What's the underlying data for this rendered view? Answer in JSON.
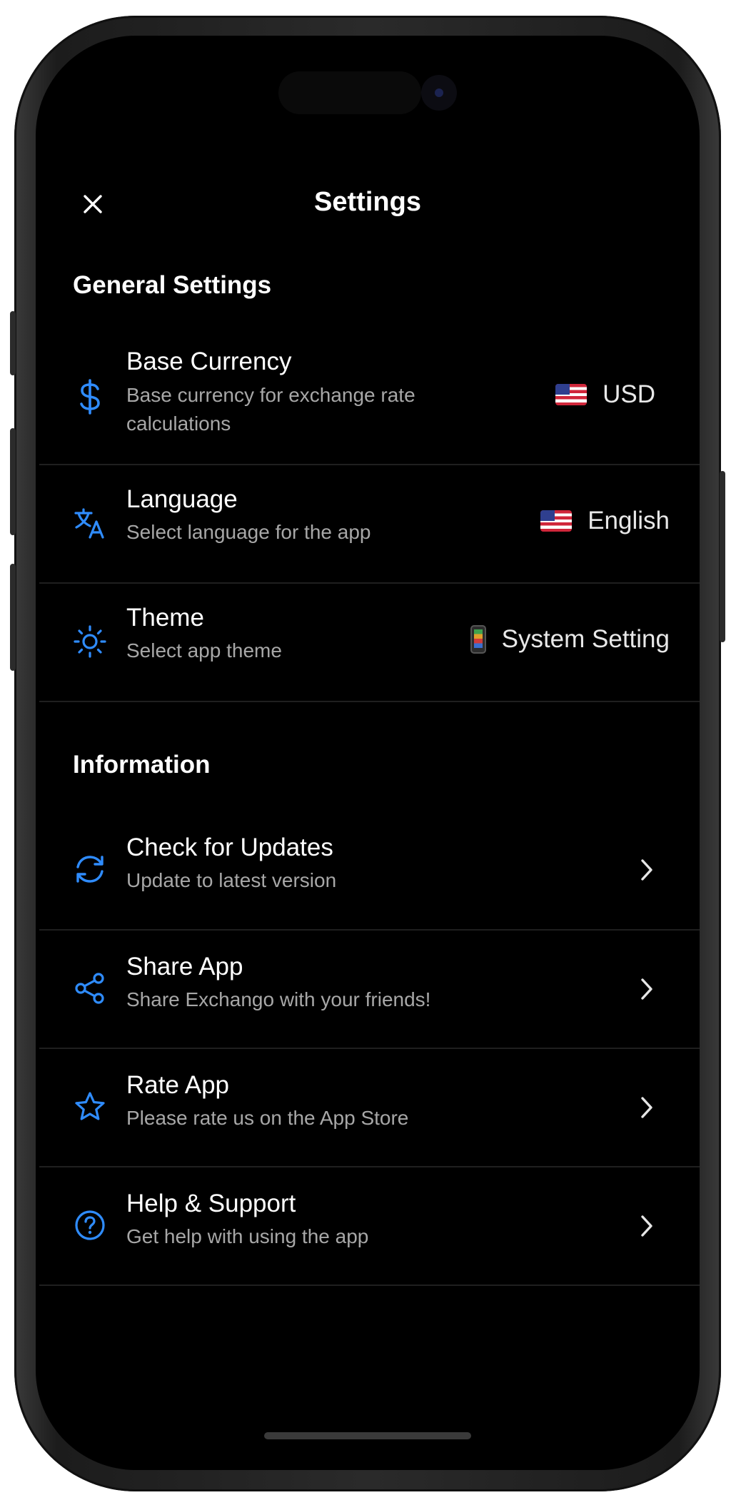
{
  "header": {
    "title": "Settings",
    "close_icon": "close-icon"
  },
  "colors": {
    "accent": "#2f8cff",
    "background": "#000000",
    "text": "#ffffff",
    "subtext": "#a7a7a7",
    "divider": "#1f1f1f"
  },
  "general": {
    "title": "General Settings",
    "items": [
      {
        "label": "Base Currency",
        "sub1": "Base currency for exchange rate",
        "sub2": "calculations",
        "value": "USD",
        "icon": "dollar-icon",
        "value_icon": "us-flag-icon"
      },
      {
        "label": "Language",
        "sub1": "Select language for the app",
        "value": "English",
        "icon": "translate-icon",
        "value_icon": "us-flag-icon"
      },
      {
        "label": "Theme",
        "sub1": "Select app theme",
        "value": "System Setting",
        "icon": "sun-icon",
        "value_icon": "phone-icon"
      }
    ]
  },
  "information": {
    "title": "Information",
    "items": [
      {
        "label": "Check for Updates",
        "sub1": "Update to latest version",
        "icon": "refresh-icon"
      },
      {
        "label": "Share App",
        "sub1": "Share Exchango with your friends!",
        "icon": "share-icon"
      },
      {
        "label": "Rate App",
        "sub1": "Please rate us on the App Store",
        "icon": "star-icon"
      },
      {
        "label": "Help & Support",
        "sub1": "Get help with using the app",
        "icon": "help-icon"
      }
    ]
  }
}
